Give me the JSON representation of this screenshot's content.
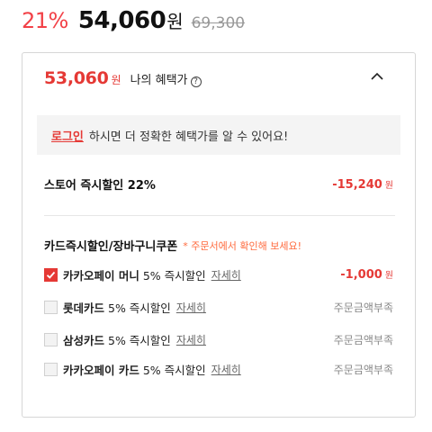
{
  "price": {
    "discount_rate": "21%",
    "sale_price": "54,060",
    "currency": "원",
    "original_price": "69,300"
  },
  "benefit": {
    "my_price": "53,060",
    "my_price_unit": "원",
    "my_price_label": "나의 혜택가",
    "info_icon": "question-circle-icon",
    "collapse_icon": "chevron-up-icon",
    "login_link": "로그인",
    "login_notice": "하시면 더 정확한 혜택가를 알 수 있어요!",
    "store_discount": {
      "label": "스토어 즉시할인 22%",
      "amount": "-15,240",
      "unit": "원"
    },
    "card_section": {
      "title": "카드즉시할인/장바구니쿠폰",
      "note": "* 주문서에서 확인해 보세요!"
    },
    "card_options": [
      {
        "name": "카카오페이 머니",
        "desc": "5% 즉시할인",
        "detail": "자세히",
        "checked": true,
        "amount": "-1,000",
        "unit": "원",
        "status": ""
      },
      {
        "name": "롯데카드",
        "desc": "5% 즉시할인",
        "detail": "자세히",
        "checked": false,
        "amount": "",
        "unit": "",
        "status": "주문금액부족"
      },
      {
        "name": "삼성카드",
        "desc": "5% 즉시할인",
        "detail": "자세히",
        "checked": false,
        "amount": "",
        "unit": "",
        "status": "주문금액부족"
      },
      {
        "name": "카카오페이 카드",
        "desc": "5% 즉시할인",
        "detail": "자세히",
        "checked": false,
        "amount": "",
        "unit": "",
        "status": "주문금액부족"
      }
    ],
    "colors": {
      "accent": "#e53935",
      "note": "#ff6a3d",
      "muted": "#888888"
    }
  }
}
